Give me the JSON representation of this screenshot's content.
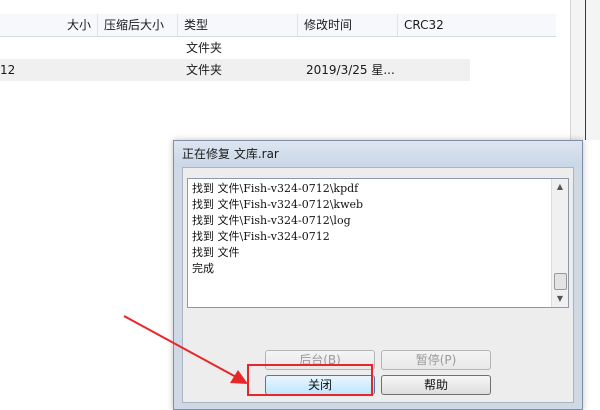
{
  "file_list": {
    "columns": [
      "大小",
      "压缩后大小",
      "类型",
      "修改时间",
      "CRC32"
    ],
    "rows": [
      {
        "name": "",
        "type": "文件夹",
        "modified": ""
      },
      {
        "name": "12",
        "type": "文件夹",
        "modified": "2019/3/25 星..."
      }
    ]
  },
  "dialog": {
    "title": "正在修复 文库.rar",
    "log_lines": [
      "找到 文件\\Fish-v324-0712\\kpdf",
      "找到 文件\\Fish-v324-0712\\kweb",
      "找到 文件\\Fish-v324-0712\\log",
      "找到 文件\\Fish-v324-0712",
      "找到 文件",
      "完成"
    ],
    "buttons": {
      "background": "后台(B)",
      "pause": "暂停(P)",
      "close": "关闭",
      "help": "帮助"
    }
  },
  "colors": {
    "annotation_red": "#e8262a",
    "dialog_frame": "#cfd9e6"
  }
}
